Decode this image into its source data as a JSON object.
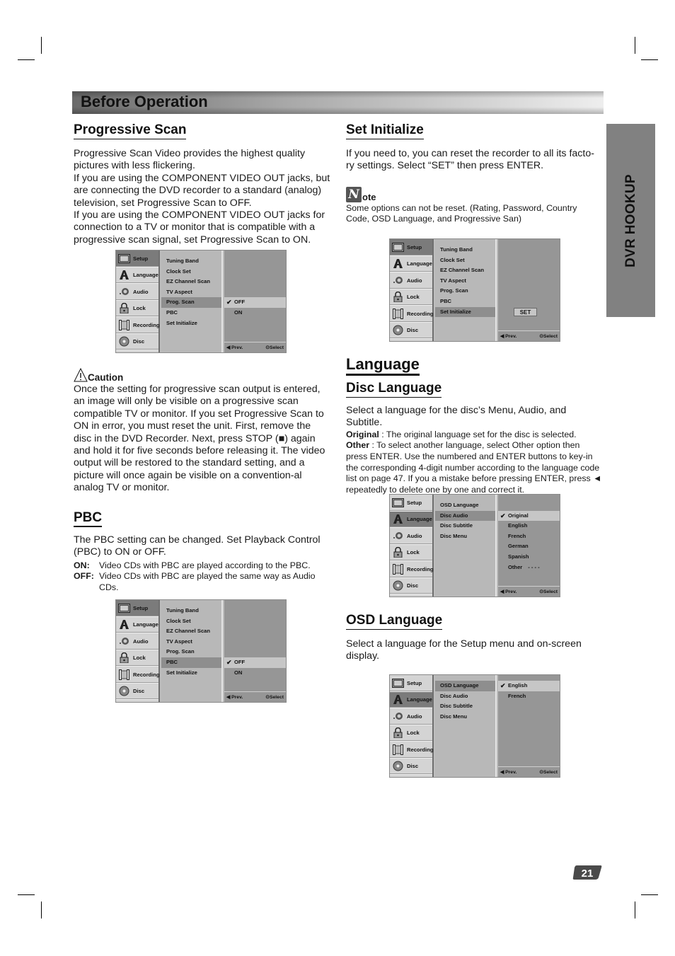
{
  "page": {
    "title": "Before Operation",
    "side_tab": "DVR HOOKUP",
    "page_number": "21"
  },
  "progressive_scan": {
    "heading": "Progressive Scan",
    "paragraphs": [
      "Progressive Scan Video provides the highest quality pictures with less flickering.",
      "If you are using the COMPONENT VIDEO OUT jacks, but are connecting the DVD recorder to a standard (analog) television, set Progressive Scan to OFF.",
      "If you are using the COMPONENT VIDEO OUT jacks for connection to a TV or monitor that is compatible with a progressive scan signal, set Progressive Scan to ON."
    ],
    "caution_label": "Caution",
    "caution_text": "Once the setting for progressive scan output is entered, an image will only be visible on a progressive scan compatible TV or monitor. If you set Progressive Scan to ON in error, you must reset the unit. First, remove the disc in the DVD Recorder. Next, press STOP (■) again and hold it for five seconds before releasing it. The video output will be restored to the standard setting, and a picture will once again be visible on a convention-al analog TV or monitor."
  },
  "pbc": {
    "heading": "PBC",
    "intro": "The PBC setting can be changed. Set Playback Control (PBC) to ON or OFF.",
    "on_label": "ON:",
    "on_text": "Video CDs with PBC are played according to the PBC.",
    "off_label": "OFF:",
    "off_text": "Video CDs with PBC are played the same way as Audio CDs."
  },
  "set_initialize": {
    "heading": "Set Initialize",
    "text": "If you need to, you can reset the recorder to all its facto-ry settings. Select “SET” then press ENTER.",
    "note_icon_letter": "N",
    "note_label": "ote",
    "note_text": "Some options can not be reset. (Rating, Password, Country Code, OSD Language, and Progressive San)"
  },
  "language": {
    "heading": "Language",
    "disc_heading": "Disc Language",
    "disc_intro": "Select a language for the disc’s Menu, Audio, and Subtitle.",
    "original_label": "Original",
    "original_text": " : The original language set for the disc is selected.",
    "other_label": "Other",
    "other_text": " : To select another language, select Other option then press ENTER. Use the numbered and ENTER buttons to key-in the corresponding 4-digit number according to the language code list on page 47. If you a mistake before pressing ENTER, press ◄ repeatedly to delete one by one and correct it.",
    "osd_heading": "OSD Language",
    "osd_text": "Select a language for the Setup menu and on-screen display."
  },
  "osd_common": {
    "categories": [
      "Setup",
      "Language",
      "Audio",
      "Lock",
      "Recording",
      "Disc"
    ],
    "prev_label": "Prev.",
    "select_label": "Select"
  },
  "menus": {
    "prog_scan": {
      "active_category": 0,
      "items": [
        "Tuning Band",
        "Clock Set",
        "EZ Channel Scan",
        "TV Aspect",
        "Prog. Scan",
        "PBC",
        "Set Initialize"
      ],
      "active_item": 4,
      "options": [
        "OFF",
        "ON"
      ],
      "checked_option": 0
    },
    "pbc": {
      "active_category": 0,
      "items": [
        "Tuning Band",
        "Clock Set",
        "EZ Channel Scan",
        "TV Aspect",
        "Prog. Scan",
        "PBC",
        "Set Initialize"
      ],
      "active_item": 5,
      "options": [
        "OFF",
        "ON"
      ],
      "checked_option": 0
    },
    "set_init": {
      "active_category": 0,
      "items": [
        "Tuning Band",
        "Clock Set",
        "EZ Channel Scan",
        "TV Aspect",
        "Prog. Scan",
        "PBC",
        "Set Initialize"
      ],
      "active_item": 6,
      "set_button": "SET"
    },
    "disc_lang": {
      "active_category": 1,
      "items": [
        "OSD Language",
        "Disc Audio",
        "Disc Subtitle",
        "Disc Menu"
      ],
      "active_item": 1,
      "options": [
        "Original",
        "English",
        "French",
        "German",
        "Spanish",
        "Other"
      ],
      "other_code": "- - - -",
      "checked_option": 0
    },
    "osd_lang": {
      "active_category": 1,
      "items": [
        "OSD Language",
        "Disc Audio",
        "Disc Subtitle",
        "Disc Menu"
      ],
      "active_item": 0,
      "options": [
        "English",
        "French"
      ],
      "checked_option": 0
    }
  }
}
